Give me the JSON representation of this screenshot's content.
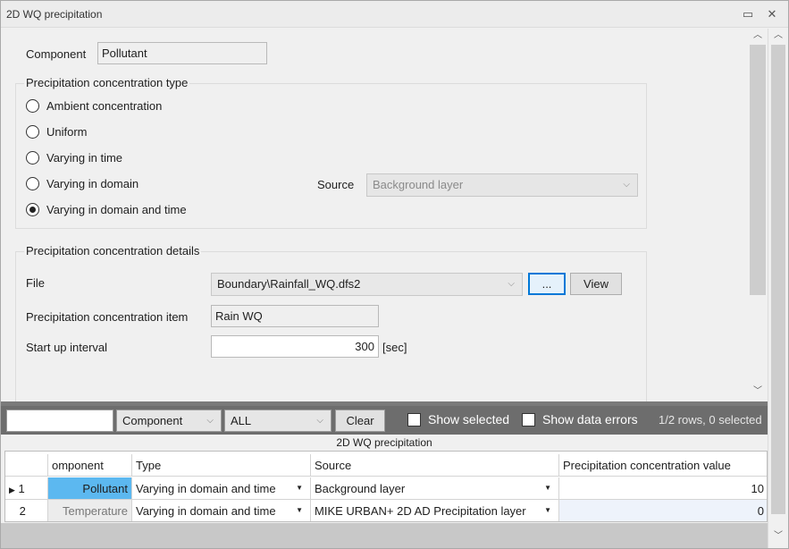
{
  "window": {
    "title": "2D WQ precipitation",
    "restore_glyph": "▭",
    "close_glyph": "✕"
  },
  "form": {
    "component_label": "Component",
    "component_value": "Pollutant",
    "type_group": {
      "title": "Precipitation concentration type",
      "options": [
        {
          "label": "Ambient concentration",
          "selected": false
        },
        {
          "label": "Uniform",
          "selected": false
        },
        {
          "label": "Varying in time",
          "selected": false
        },
        {
          "label": "Varying in domain",
          "selected": false
        },
        {
          "label": "Varying in domain and time",
          "selected": true
        }
      ],
      "source_label": "Source",
      "source_value": "Background layer"
    },
    "details_group": {
      "title": "Precipitation concentration details",
      "file_label": "File",
      "file_value": "Boundary\\Rainfall_WQ.dfs2",
      "browse_label": "...",
      "view_label": "View",
      "item_label": "Precipitation concentration item",
      "item_value": "Rain WQ",
      "startup_label": "Start up  interval",
      "startup_value": "300",
      "startup_unit": "[sec]"
    }
  },
  "filterbar": {
    "search_value": "",
    "field_combo": "Component",
    "value_combo": "ALL",
    "clear_label": "Clear",
    "show_selected_label": "Show selected",
    "show_errors_label": "Show data errors",
    "status": "1/2 rows, 0 selected"
  },
  "grid": {
    "caption": "2D WQ precipitation",
    "columns": [
      "omponent",
      "Type",
      "Source",
      "Precipitation concentration value"
    ],
    "rows": [
      {
        "indicator": "▶",
        "num": "1",
        "component": "Pollutant",
        "type": "Varying in domain and time",
        "source": "Background layer",
        "value": "10"
      },
      {
        "indicator": "",
        "num": "2",
        "component": "Temperature",
        "type": "Varying in domain and time",
        "source": "MIKE URBAN+ 2D AD Precipitation layer",
        "value": "0"
      }
    ]
  },
  "colors": {
    "selected_cell": "#5cb8f0",
    "splitter": "#6d6d6d",
    "focus_border": "#0078d7"
  }
}
